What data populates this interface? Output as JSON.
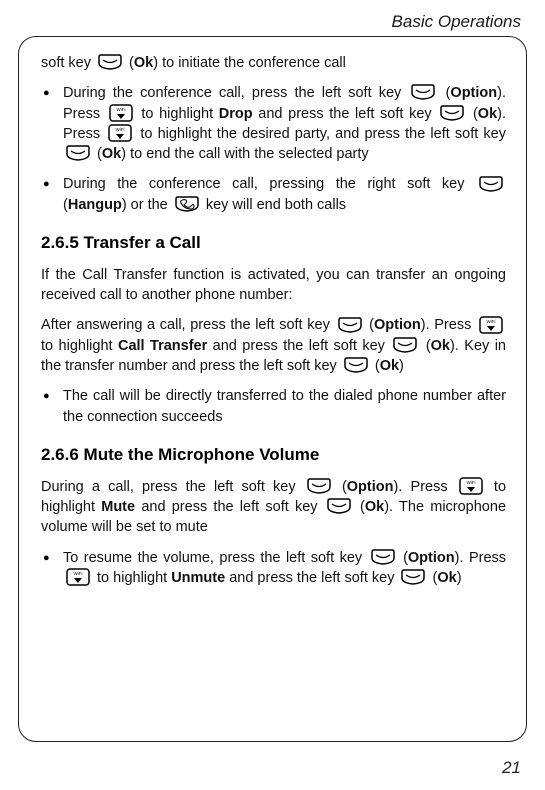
{
  "header": {
    "title": "Basic Operations"
  },
  "page": {
    "number": "21"
  },
  "intro_line": {
    "pre": "soft key ",
    "ok": "Ok",
    "post": ") to initiate the conference call"
  },
  "bul_conf1": {
    "a": "During the conference call, press the left soft key ",
    "b": "Option",
    "c": "). Press ",
    "d": " to highlight ",
    "e": "Drop",
    "f": " and press the left soft key ",
    "g": "Ok",
    "h": "). Press ",
    "i": " to highlight the desired party, and press the left soft key ",
    "j": "Ok",
    "k": ") to end the call with the selected party"
  },
  "bul_conf2": {
    "a": "During the conference call, pressing the right soft key ",
    "b": "Hangup",
    "c": ") or the ",
    "d": " key will end both calls"
  },
  "sec265": {
    "title": "2.6.5 Transfer a Call"
  },
  "p265a": "If the Call Transfer function is activated, you can transfer an ongoing received call to another phone number:",
  "p265b": {
    "a": "After answering a call, press the left soft key ",
    "b": "Option",
    "c": "). Press ",
    "d": " to highlight ",
    "e": "Call Transfer",
    "f": " and press the left soft key ",
    "g": "Ok",
    "h": "). Key in the transfer number and press the left soft key ",
    "i": "Ok",
    "j": ")"
  },
  "bul265": "The call will be directly transferred to the dialed phone number after the connection succeeds",
  "sec266": {
    "title": "2.6.6 Mute the Microphone Volume"
  },
  "p266": {
    "a": "During a call, press the left soft key ",
    "b": "Option",
    "c": "). Press ",
    "d": " to highlight ",
    "e": "Mute",
    "f": " and press the left soft key ",
    "g": "Ok",
    "h": "). The microphone volume will be set to mute"
  },
  "bul266": {
    "a": "To resume the volume, press the left soft key ",
    "b": "Option",
    "c": "). Press ",
    "d": " to highlight ",
    "e": "Unmute",
    "f": " and press the left soft key ",
    "g": "Ok",
    "h": ")"
  }
}
